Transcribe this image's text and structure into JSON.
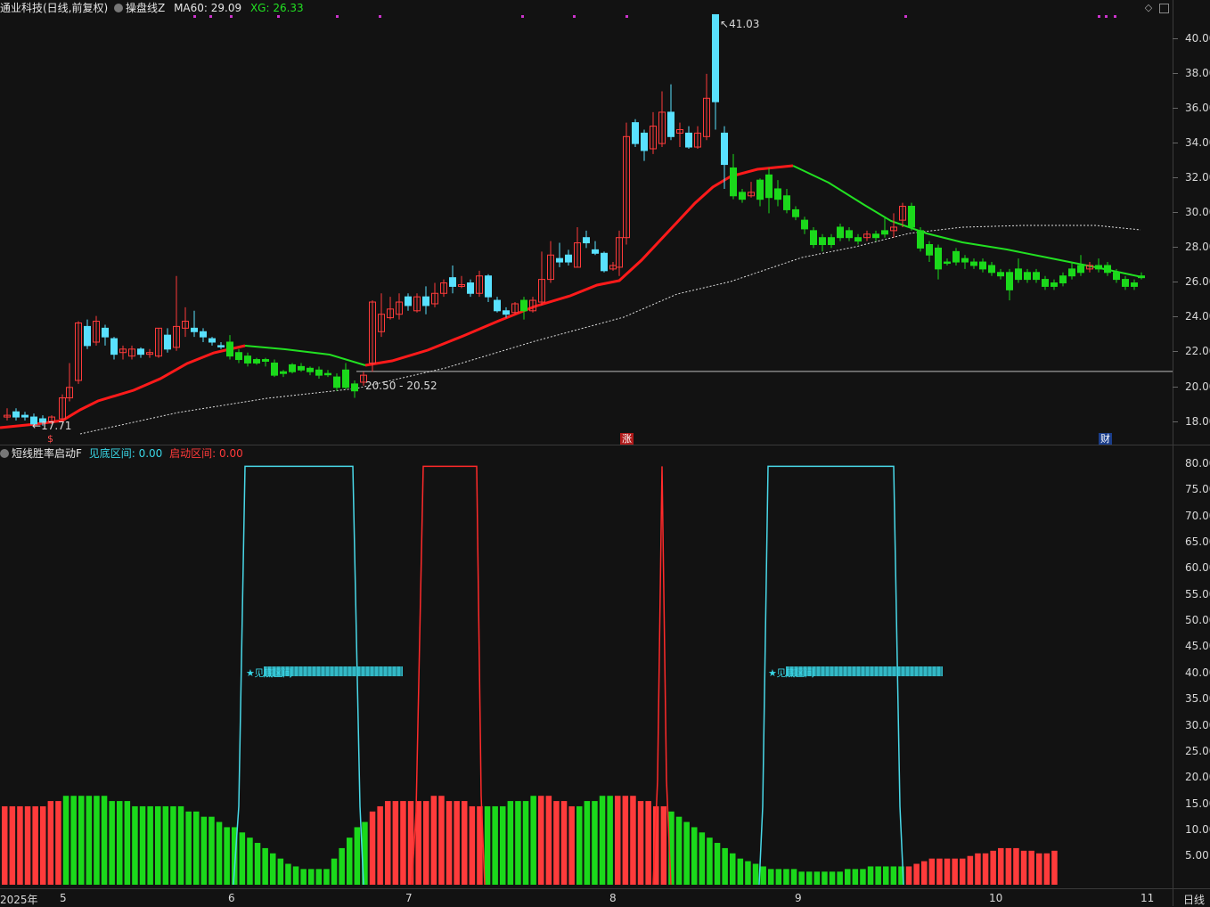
{
  "window": {
    "stock_title": "通业科技(日线,前复权)",
    "indicator_name": "操盘线Z",
    "ma60_label": "MA60: 29.09",
    "xg_label": "XG: 26.33",
    "sub_indicator": "短线胜率启动F",
    "sub_a_label": "见底区间: 0.00",
    "sub_b_label": "启动区间: 0.00",
    "period_label": "日线"
  },
  "colors": {
    "background": "#121212",
    "up_candle": "#ff3b3b",
    "down_candle": "#1bd91b",
    "cyan_candle": "#59e1ff",
    "ma_red": "#ff1a1a",
    "ma_green": "#22e022",
    "bottom_line": "#49d8e8",
    "start_line": "#ff2a2a",
    "dot_magenta": "#cc33cc"
  },
  "price_axis": [
    "40.00",
    "38.00",
    "36.00",
    "34.00",
    "32.00",
    "30.00",
    "28.00",
    "26.00",
    "24.00",
    "22.00",
    "20.00",
    "18.00"
  ],
  "sub_axis": [
    "80.00",
    "75.00",
    "70.00",
    "65.00",
    "60.00",
    "55.00",
    "50.00",
    "45.00",
    "40.00",
    "35.00",
    "30.00",
    "25.00",
    "20.00",
    "15.00",
    "10.00",
    "5.00"
  ],
  "x_axis": [
    "2025年",
    "5",
    "6",
    "7",
    "8",
    "9",
    "10",
    "11"
  ],
  "annotations": {
    "high": "41.03",
    "low_range": "20.50 - 20.52",
    "start_low": "17.71"
  },
  "markers": {
    "dollar": "$",
    "rise": "涨",
    "fin": "财"
  },
  "signal_labels": [
    "★见底区间",
    "★见底区间"
  ],
  "icons": [
    "circle-icon",
    "collapse-icon",
    "window-icon"
  ]
}
